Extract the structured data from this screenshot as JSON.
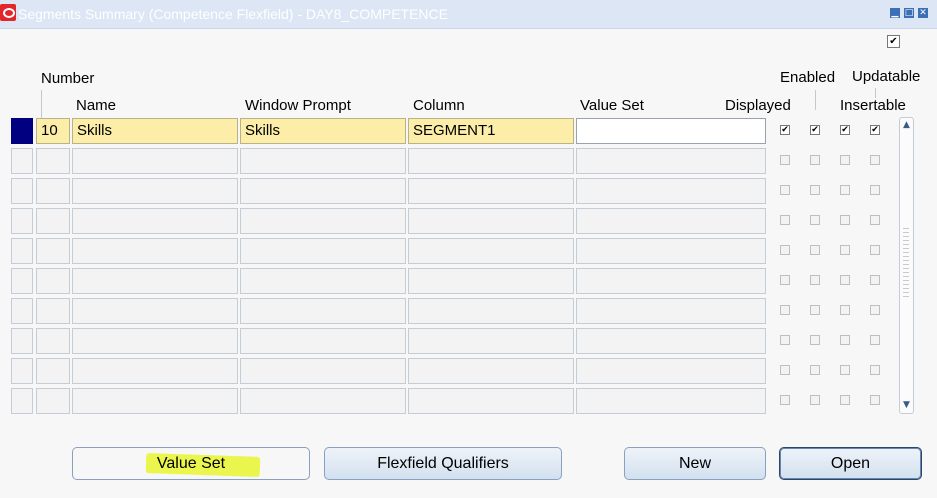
{
  "window": {
    "title": "Segments Summary (Competence Flexfield) - DAY8_COMPETENCE",
    "app_icon_letter": "O"
  },
  "headers": {
    "number": "Number",
    "name": "Name",
    "window_prompt": "Window Prompt",
    "column": "Column",
    "value_set": "Value Set",
    "displayed": "Displayed",
    "enabled": "Enabled",
    "insertable": "Insertable",
    "updatable": "Updatable"
  },
  "rows": [
    {
      "number": "10",
      "name": "Skills",
      "window_prompt": "Skills",
      "column": "SEGMENT1",
      "value_set": "",
      "displayed": true,
      "enabled": true,
      "insertable": true,
      "updatable": true
    },
    {
      "number": "",
      "name": "",
      "window_prompt": "",
      "column": "",
      "value_set": "",
      "displayed": false,
      "enabled": false,
      "insertable": false,
      "updatable": false
    },
    {
      "number": "",
      "name": "",
      "window_prompt": "",
      "column": "",
      "value_set": "",
      "displayed": false,
      "enabled": false,
      "insertable": false,
      "updatable": false
    },
    {
      "number": "",
      "name": "",
      "window_prompt": "",
      "column": "",
      "value_set": "",
      "displayed": false,
      "enabled": false,
      "insertable": false,
      "updatable": false
    },
    {
      "number": "",
      "name": "",
      "window_prompt": "",
      "column": "",
      "value_set": "",
      "displayed": false,
      "enabled": false,
      "insertable": false,
      "updatable": false
    },
    {
      "number": "",
      "name": "",
      "window_prompt": "",
      "column": "",
      "value_set": "",
      "displayed": false,
      "enabled": false,
      "insertable": false,
      "updatable": false
    },
    {
      "number": "",
      "name": "",
      "window_prompt": "",
      "column": "",
      "value_set": "",
      "displayed": false,
      "enabled": false,
      "insertable": false,
      "updatable": false
    },
    {
      "number": "",
      "name": "",
      "window_prompt": "",
      "column": "",
      "value_set": "",
      "displayed": false,
      "enabled": false,
      "insertable": false,
      "updatable": false
    },
    {
      "number": "",
      "name": "",
      "window_prompt": "",
      "column": "",
      "value_set": "",
      "displayed": false,
      "enabled": false,
      "insertable": false,
      "updatable": false
    },
    {
      "number": "",
      "name": "",
      "window_prompt": "",
      "column": "",
      "value_set": "",
      "displayed": false,
      "enabled": false,
      "insertable": false,
      "updatable": false
    }
  ],
  "top_checkbox_checked": true,
  "buttons": {
    "value_set": "Value Set",
    "flexfield_qualifiers": "Flexfield Qualifiers",
    "new": "New",
    "open": "Open"
  },
  "icons": {
    "minimize": "minimize-icon",
    "maximize": "maximize-icon",
    "close": "close-icon",
    "scroll_up": "arrow-up-icon",
    "scroll_down": "arrow-down-icon",
    "check": "check-icon"
  },
  "colors": {
    "active_cell": "#fceea8",
    "record_indicator": "#000080",
    "titlebar": "#dce6f4",
    "highlight": "#e8f530"
  }
}
